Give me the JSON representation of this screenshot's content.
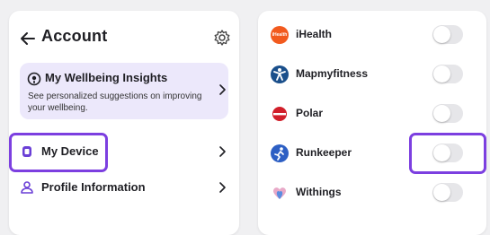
{
  "account": {
    "title": "Account",
    "insights": {
      "title": "My Wellbeing Insights",
      "description": "See personalized suggestions on improving your wellbeing."
    },
    "menu": [
      {
        "label": "My Device",
        "icon": "watch-icon",
        "highlighted": true
      },
      {
        "label": "Profile Information",
        "icon": "person-icon",
        "highlighted": false
      }
    ]
  },
  "apps": {
    "items": [
      {
        "name": "iHealth",
        "logo_text": "iHealth",
        "color": "#f25a1e",
        "enabled": false
      },
      {
        "name": "Mapmyfitness",
        "color": "#1a4f8b",
        "enabled": false
      },
      {
        "name": "Polar",
        "color": "#d11f2a",
        "enabled": false
      },
      {
        "name": "Runkeeper",
        "color": "#2d5fc4",
        "enabled": false,
        "highlighted": true
      },
      {
        "name": "Withings",
        "color": "#e8a9c8",
        "enabled": false
      }
    ]
  },
  "colors": {
    "accent": "#7c3fe0",
    "card_bg": "#ece8fb",
    "toggle_off": "#e6e6e9"
  }
}
